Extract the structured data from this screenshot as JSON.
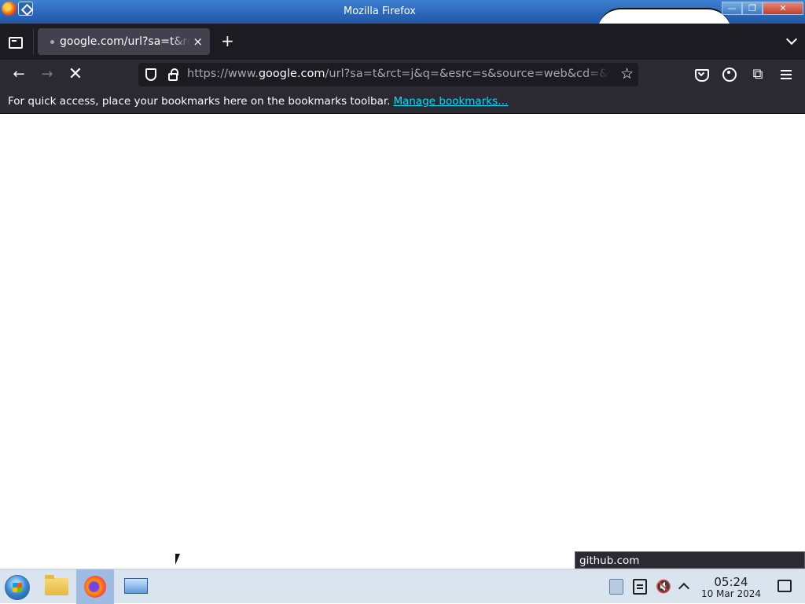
{
  "window": {
    "title": "Mozilla Firefox",
    "controls": {
      "minimize": "—",
      "maximize": "❐",
      "close": "✕"
    }
  },
  "tabs": [
    {
      "label": "google.com/url?sa=t&rct=j&q=&esrc=s&source=web&cd=&ved",
      "loading": true,
      "close": "×"
    }
  ],
  "new_tab_label": "+",
  "navbar": {
    "back": "←",
    "forward": "→",
    "stop": "✕",
    "url_prefix": "https://www.",
    "url_domain": "google.com",
    "url_suffix": "/url?sa=t&rct=j&q=&esrc=s&source=web&cd=&ved=",
    "bookmark_star": "☆",
    "extensions": "⧉"
  },
  "bookmarks_bar": {
    "message": "For quick access, place your bookmarks here on the bookmarks toolbar.",
    "link": "Manage bookmarks…"
  },
  "status_tooltip": "github.com",
  "taskbar": {
    "time": "05:24",
    "date": "10 Mar 2024",
    "mute_glyph": "🔇"
  },
  "icons": {
    "tab_overview": "tab-overview-icon",
    "shield": "shield-icon",
    "lock": "lock-icon",
    "pocket": "pocket-icon",
    "account": "account-icon",
    "extensions": "extensions-icon",
    "menu": "hamburger-menu-icon"
  }
}
